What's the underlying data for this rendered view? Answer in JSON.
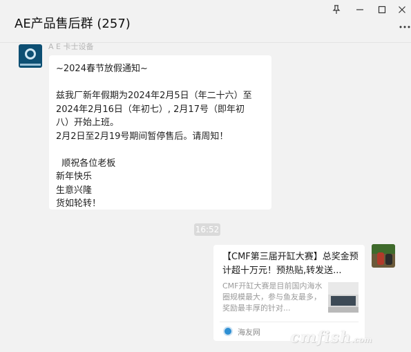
{
  "header": {
    "title": "AE产品售后群 (257)",
    "pin_icon": "pin-icon",
    "minimize_icon": "minimize-icon",
    "maximize_icon": "maximize-icon",
    "close_icon": "close-icon",
    "more_icon": "more-options-icon"
  },
  "messages": [
    {
      "sender_name": "A E 卡士设备",
      "lines": [
        "~2024春节放假通知~",
        "",
        "兹我厂新年假期为2024年2月5日（年二十六）至",
        "2024年2月16日（年初七）, 2月17号（即年初",
        "八）开始上班。",
        "2月2日至2月19号期间暂停售后。请周知！",
        "",
        "  顺祝各位老板",
        "新年快乐",
        "生意兴隆",
        "货如轮转！"
      ]
    }
  ],
  "timestamp": "16:52",
  "shared_card": {
    "title": "【CMF第三届开缸大赛】总奖金预计超十万元！预热贴,转发送...",
    "description": "CMF开缸大赛是目前国内海水圈规模最大，参与鱼友最多，奖励最丰厚的针对...",
    "source": "海友网"
  },
  "watermark": {
    "text": "cmfish",
    "suffix": ".com"
  },
  "colors": {
    "background": "#f2f2f2",
    "bubble": "#ffffff",
    "time_chip": "#dadada"
  }
}
